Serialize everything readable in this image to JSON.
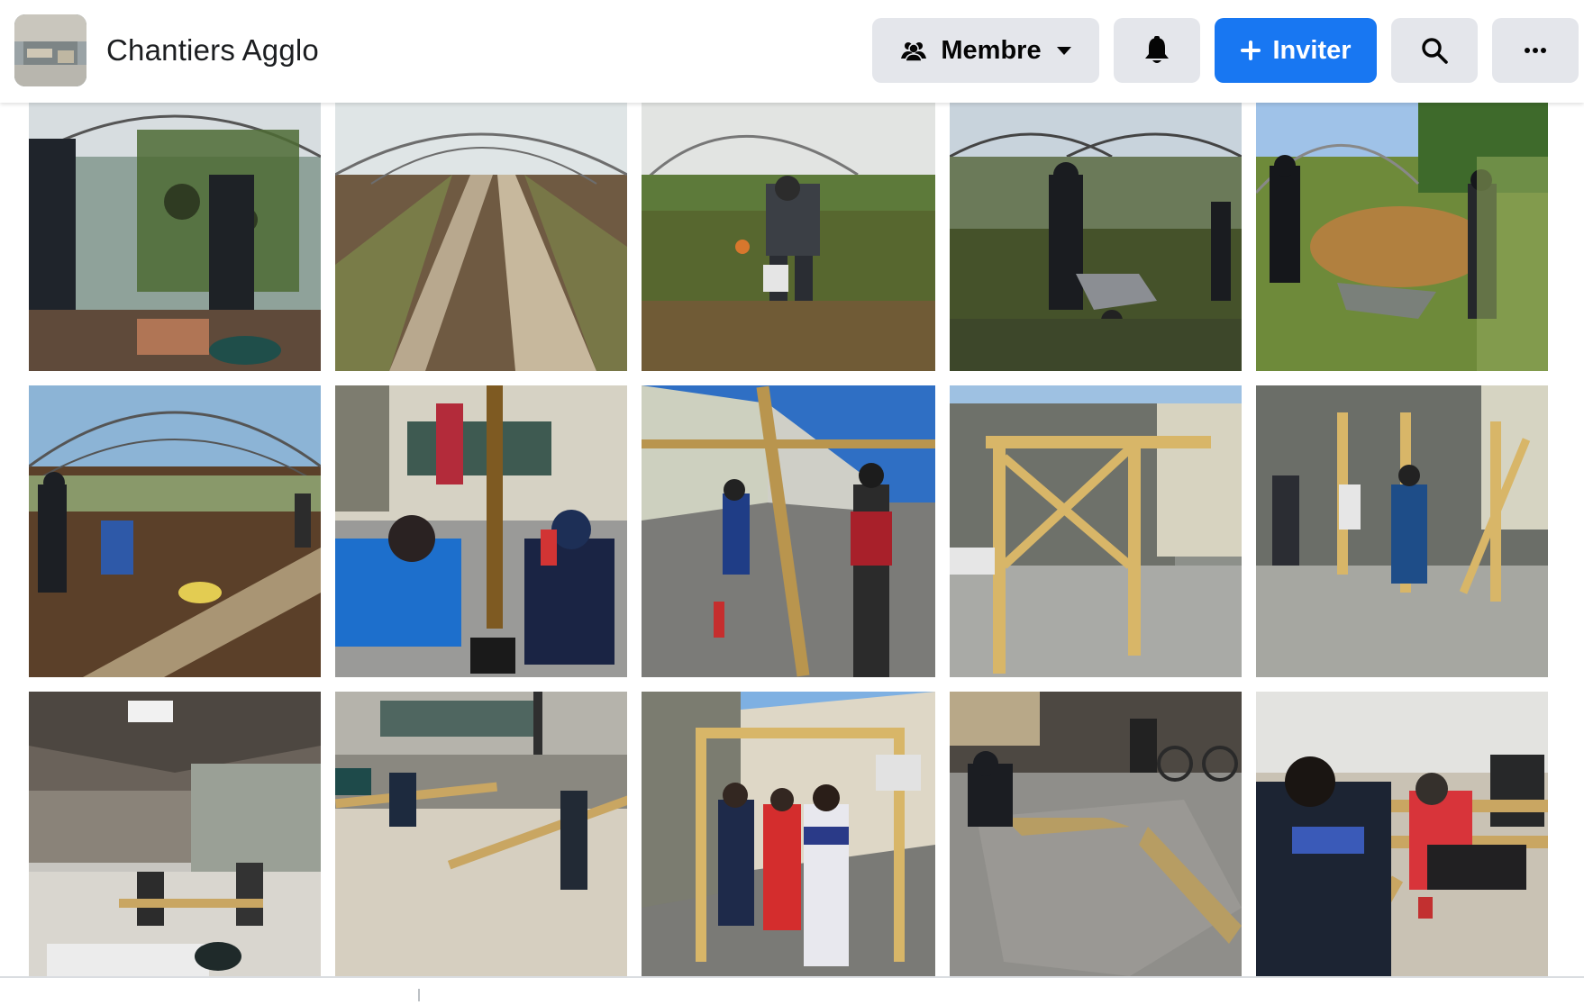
{
  "header": {
    "group_name": "Chantiers Agglo",
    "member_label": "Membre",
    "invite_label": "Inviter"
  },
  "icons": {
    "group_thumbnail": "group-photo",
    "member": "people-icon",
    "member_caret": "caret-down-icon",
    "notifications": "bell-icon",
    "invite": "plus-icon",
    "search": "search-icon",
    "more": "more-dots-icon"
  },
  "colors": {
    "invite_bg": "#1877f2",
    "button_bg": "#e4e6eb",
    "text": "#1c1e21"
  },
  "photos": [
    {
      "scene": "greenhouse-plants"
    },
    {
      "scene": "greenhouse-rows"
    },
    {
      "scene": "greenhouse-worker-bucket"
    },
    {
      "scene": "greenhouse-wheelbarrow"
    },
    {
      "scene": "wood-chips-wheelbarrow"
    },
    {
      "scene": "greenhouse-planting"
    },
    {
      "scene": "courtyard-paint-fire-extinguisher"
    },
    {
      "scene": "courtyard-spray-wood"
    },
    {
      "scene": "wooden-frame-yard"
    },
    {
      "scene": "wooden-frame-workers"
    },
    {
      "scene": "warehouse-workbenches"
    },
    {
      "scene": "workshop-sawhorses"
    },
    {
      "scene": "wooden-frame-group"
    },
    {
      "scene": "garage-wood-floor"
    },
    {
      "scene": "workshop-wood-assembly"
    }
  ]
}
